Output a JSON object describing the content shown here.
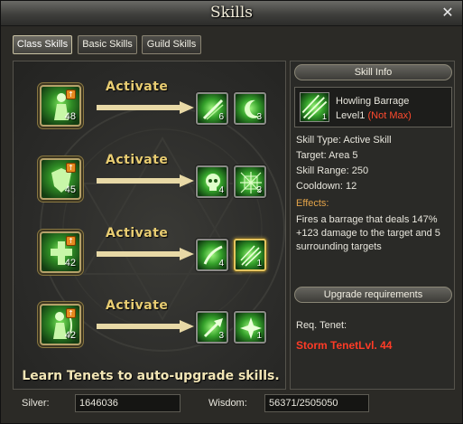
{
  "window": {
    "title": "Skills",
    "close_glyph": "✕"
  },
  "tabs": [
    {
      "label": "Class Skills",
      "active": true
    },
    {
      "label": "Basic Skills",
      "active": false
    },
    {
      "label": "Guild Skills",
      "active": false
    }
  ],
  "activate_label": "Activate",
  "rows": [
    {
      "tenet_level": "48",
      "skills": [
        {
          "level": "6",
          "icon": "green-streak-icon"
        },
        {
          "level": "3",
          "icon": "green-crescent-icon"
        }
      ]
    },
    {
      "tenet_level": "45",
      "skills": [
        {
          "level": "4",
          "icon": "green-skull-icon"
        },
        {
          "level": "3",
          "icon": "green-web-icon"
        }
      ]
    },
    {
      "tenet_level": "42",
      "skills": [
        {
          "level": "4",
          "icon": "green-slash-icon"
        },
        {
          "level": "1",
          "icon": "howling-barrage-icon"
        }
      ]
    },
    {
      "tenet_level": "42",
      "skills": [
        {
          "level": "3",
          "icon": "green-arrow-icon"
        },
        {
          "level": "1",
          "icon": "green-burst-icon"
        }
      ]
    }
  ],
  "tip": "Learn Tenets to auto-upgrade skills.",
  "skill_info": {
    "header": "Skill Info",
    "icon_level": "1",
    "name": "Howling Barrage",
    "level_text": "Level1",
    "not_max": "(Not Max)",
    "type": "Skill Type: Active Skill",
    "target": "Target: Area 5",
    "range": "Skill Range: 250",
    "cooldown": "Cooldown: 12",
    "effects_label": "Effects:",
    "effects_desc": "Fires a barrage that deals 147% +123 damage to the target and 5 surrounding targets"
  },
  "upgrade": {
    "header": "Upgrade requirements",
    "req_label": "Req. Tenet:",
    "req_value": "Storm TenetLvl. 44"
  },
  "bottom": {
    "silver_label": "Silver:",
    "silver_value": "1646036",
    "wisdom_label": "Wisdom:",
    "wisdom_value": "56371/2505050"
  },
  "colors": {
    "accent_gold": "#e9cd72",
    "warning_red": "#ff3b26",
    "skill_green": "#34a02a"
  }
}
